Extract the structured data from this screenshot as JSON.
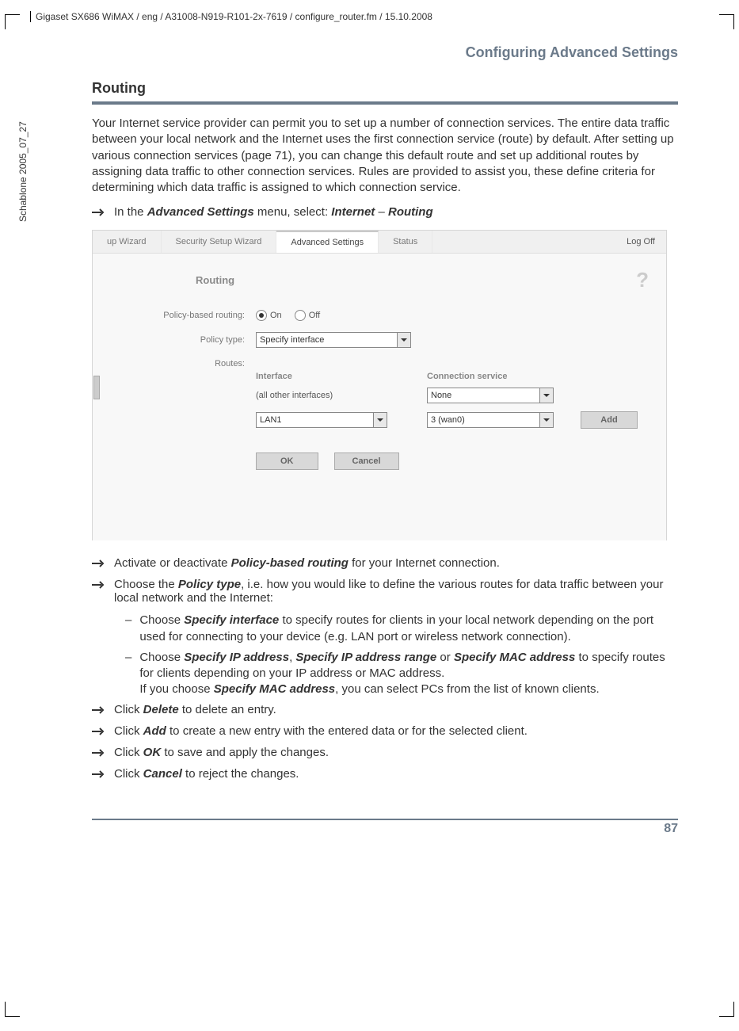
{
  "header_path": "Gigaset SX686 WiMAX / eng / A31008-N919-R101-2x-7619 / configure_router.fm / 15.10.2008",
  "side_label": "Schablone 2005_07_27",
  "section_header": "Configuring Advanced Settings",
  "title": "Routing",
  "intro": "Your Internet service provider can permit you to set up a number of connection services. The entire data traffic between your local network and the Internet uses the first connection service (route) by default. After setting up various connection services (page 71), you can change this default route and set up additional routes by assigning data traffic to other connection services. Rules are provided to assist you, these define criteria for determining which data traffic is assigned to which connection service.",
  "nav_instruction_pre": "In the ",
  "nav_instruction_b1": "Advanced Settings",
  "nav_instruction_mid": " menu, select: ",
  "nav_instruction_b2": "Internet",
  "nav_instruction_sep": " – ",
  "nav_instruction_b3": "Routing",
  "ui": {
    "tabs": {
      "setup_wizard": "up Wizard",
      "security_wizard": "Security Setup Wizard",
      "advanced": "Advanced Settings",
      "status": "Status",
      "logoff": "Log Off"
    },
    "panel_title": "Routing",
    "help": "?",
    "labels": {
      "policy_routing": "Policy-based routing:",
      "policy_type": "Policy type:",
      "routes": "Routes:"
    },
    "radio": {
      "on": "On",
      "off": "Off"
    },
    "policy_type_value": "Specify interface",
    "cols": {
      "interface": "Interface",
      "conn": "Connection service"
    },
    "row1": {
      "interface": "(all other interfaces)",
      "conn": "None"
    },
    "row2": {
      "interface": "LAN1",
      "conn": "3 (wan0)"
    },
    "buttons": {
      "add": "Add",
      "ok": "OK",
      "cancel": "Cancel"
    }
  },
  "steps": {
    "s1_pre": "Activate or deactivate ",
    "s1_b": "Policy-based routing",
    "s1_post": " for your Internet connection.",
    "s2_pre": "Choose the ",
    "s2_b": "Policy type",
    "s2_post": ", i.e. how you would like to define the various routes for data traffic between your local network and the Internet:",
    "d1_pre": "Choose ",
    "d1_b": "Specify interface",
    "d1_post": " to specify routes for clients in your local network depending on the port used for connecting to your device (e.g. LAN port or wireless network connection).",
    "d2_pre": "Choose ",
    "d2_b1": "Specify IP address",
    "d2_mid1": ", ",
    "d2_b2": "Specify IP address range",
    "d2_mid2": " or ",
    "d2_b3": "Specify MAC address",
    "d2_post": " to specify routes for clients depending on your IP address or MAC address.",
    "d2_line2_pre": "If you choose ",
    "d2_line2_b": "Specify MAC address",
    "d2_line2_post": ", you can select PCs from the list of known clients.",
    "s3_pre": "Click ",
    "s3_b": "Delete",
    "s3_post": " to delete an entry.",
    "s4_pre": "Click ",
    "s4_b": "Add",
    "s4_post": " to create a new entry with the entered data or for the selected client.",
    "s5_pre": "Click ",
    "s5_b": "OK",
    "s5_post": " to save and apply the changes.",
    "s6_pre": "Click ",
    "s6_b": "Cancel",
    "s6_post": " to reject the changes."
  },
  "page_num": "87"
}
